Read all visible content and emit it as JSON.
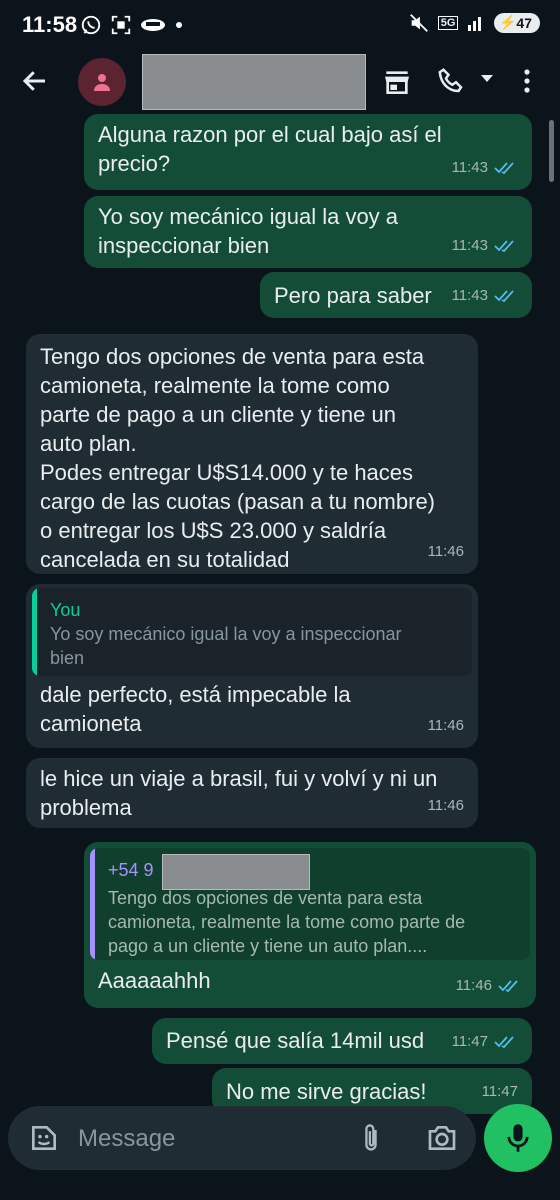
{
  "status_bar": {
    "time": "11:58",
    "network": "5G",
    "battery": "47"
  },
  "header": {
    "contact_name": ""
  },
  "messages": [
    {
      "type": "out",
      "text": "Alguna razon por el cual bajo así el\nprecio?",
      "time": "11:43"
    },
    {
      "type": "out",
      "text": "Yo soy mecánico igual la voy a\ninspeccionar bien",
      "time": "11:43"
    },
    {
      "type": "out",
      "text": "Pero para saber",
      "time": "11:43"
    },
    {
      "type": "in",
      "text": "Tengo dos opciones de venta para esta\ncamioneta, realmente la tome como\nparte de pago a un cliente y tiene un\nauto plan.\nPodes entregar U$S14.000 y te haces\ncargo de las cuotas (pasan a tu nombre)\no entregar los U$S 23.000 y saldría\ncancelada en su totalidad",
      "time": "11:46"
    },
    {
      "type": "in",
      "quote_name": "You",
      "quote_text": "Yo soy mecánico igual la voy a inspeccionar\nbien",
      "text": "dale perfecto, está impecable la\ncamioneta",
      "time": "11:46"
    },
    {
      "type": "in",
      "text": "le hice un viaje a brasil, fui y volví y ni un\nproblema",
      "time": "11:46"
    },
    {
      "type": "out",
      "quote_name": "+54 9",
      "quote_text": "Tengo dos opciones de venta para esta\ncamioneta, realmente la tome como parte de\npago a un cliente y tiene un auto plan....",
      "text": "Aaaaaahhh",
      "time": "11:46"
    },
    {
      "type": "out",
      "text": "Pensé que salía 14mil usd",
      "time": "11:47"
    },
    {
      "type": "out",
      "text": "No me sirve gracias!",
      "time": "11:47"
    }
  ],
  "composer": {
    "placeholder": "Message"
  },
  "colors": {
    "background": "#0b141a",
    "outgoing_bubble": "#144d37",
    "incoming_bubble": "#202c33",
    "read_ticks": "#53bdeb",
    "mic_button": "#21c063",
    "quote_you": "#06cf9c",
    "quote_contact": "#a791ff"
  },
  "icons": [
    "whatsapp-icon",
    "screenshot-icon",
    "car-icon",
    "mute-icon",
    "signal-icon",
    "back-arrow-icon",
    "person-icon",
    "store-icon",
    "phone-icon",
    "caret-down-icon",
    "more-vert-icon",
    "double-check-icon",
    "emoji-icon",
    "attach-icon",
    "camera-icon",
    "mic-icon"
  ]
}
